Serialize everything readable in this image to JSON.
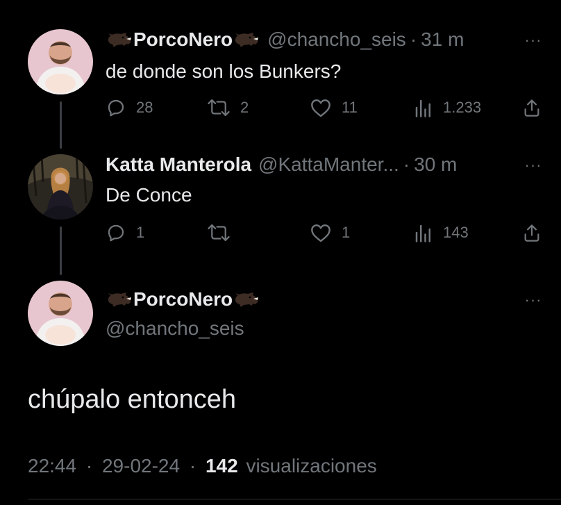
{
  "tweets": [
    {
      "display_name": "PorcoNero",
      "handle": "@chancho_seis",
      "separator": "·",
      "time": "31 m",
      "text": "de donde son los Bunkers?",
      "actions": {
        "replies": "28",
        "retweets": "2",
        "likes": "11",
        "views": "1.233"
      },
      "emoji": "boar"
    },
    {
      "display_name": "Katta Manterola",
      "handle": "@KattaManter...",
      "separator": "·",
      "time": "30 m",
      "text": "De Conce",
      "actions": {
        "replies": "1",
        "retweets": "",
        "likes": "1",
        "views": "143"
      }
    }
  ],
  "main_tweet": {
    "display_name": "PorcoNero",
    "handle": "@chancho_seis",
    "text": "chúpalo entonceh",
    "time": "22:44",
    "separator": "·",
    "date": "29-02-24",
    "views_count": "142",
    "views_label": "visualizaciones"
  },
  "more_glyph": "···",
  "colors": {
    "background": "#000000",
    "text": "#e7e9ea",
    "secondary": "#71767b"
  },
  "icons": [
    "boar-emoji",
    "reply-icon",
    "retweet-icon",
    "like-icon",
    "views-icon",
    "share-icon",
    "more-icon"
  ]
}
